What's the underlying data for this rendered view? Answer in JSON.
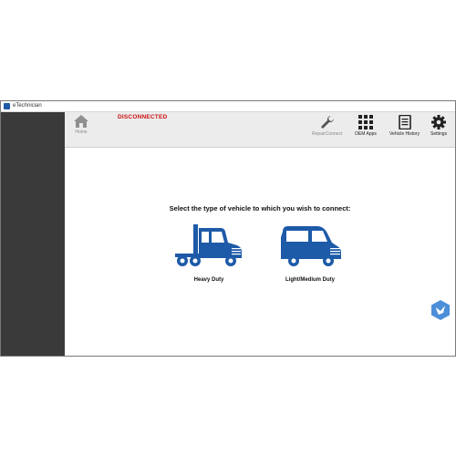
{
  "window": {
    "title": "eTechnician"
  },
  "status": {
    "connection": "DISCONNECTED"
  },
  "toolbar": {
    "home_label": "Home",
    "repair_connect_label": "RepairConnect",
    "oem_apps_label": "OEM Apps",
    "vehicle_history_label": "Vehicle History",
    "settings_label": "Settings"
  },
  "main": {
    "prompt": "Select the type of vehicle to which you wish to connect:",
    "vehicles": [
      {
        "label": "Heavy Duty",
        "icon": "semi-truck-icon"
      },
      {
        "label": "Light/Medium Duty",
        "icon": "van-icon"
      }
    ]
  },
  "colors": {
    "brand_blue": "#1d5aa8",
    "status_red": "#cc1111",
    "sidebar": "#3a3a3a",
    "toolbar": "#ececec"
  }
}
